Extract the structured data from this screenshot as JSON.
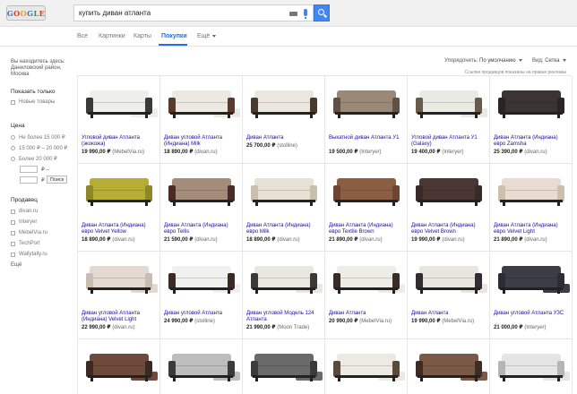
{
  "search": {
    "query": "купить диван атланта",
    "logo_text": "GOOGLE"
  },
  "tabs": [
    {
      "label": "Все",
      "active": false
    },
    {
      "label": "Картинки",
      "active": false
    },
    {
      "label": "Карты",
      "active": false
    },
    {
      "label": "Покупки",
      "active": true
    },
    {
      "label": "Ещё",
      "active": false
    }
  ],
  "sidebar": {
    "location": "Вы находитесь здесь: Даниловский район, Москва",
    "show_only_title": "Показать только",
    "new_items": "Новые товары",
    "price_title": "Цена",
    "price_options": [
      "Не более 15 000 ₽",
      "15 000 ₽ – 20 000 ₽",
      "Более 20 000 ₽"
    ],
    "price_from_suffix": "₽ –",
    "price_to_suffix": "₽",
    "price_button": "Поиск",
    "seller_title": "Продавец",
    "sellers": [
      "divan.ru",
      "Interyer",
      "MebelVia.ru",
      "TechPort",
      "Wallytally.ru"
    ],
    "more": "Ещё"
  },
  "controls": {
    "sort_label": "Упорядочить:",
    "sort_value": "По умолчанию",
    "view_label": "Вид:",
    "view_value": "Сетка",
    "ads_note": "Ссылки продавцов показаны на правах рекламы"
  },
  "products": [
    {
      "title": "Угловой диван Атланта (экокожа)",
      "price": "19 990,00 ₽",
      "seller": "(MebelVia.ru)",
      "color": "#eeeeea",
      "accent": "#3a3a3a",
      "corner": true
    },
    {
      "title": "Диван угловой Атланта (Индиана) Milk",
      "price": "18 890,00 ₽",
      "seller": "(divan.ru)",
      "color": "#ece9e1",
      "accent": "#5a3b2b",
      "corner": true
    },
    {
      "title": "Диван Атланта",
      "price": "25 700,00 ₽",
      "seller": "(stolline)",
      "color": "#ebe7df",
      "accent": "#4a3a2e",
      "corner": false
    },
    {
      "title": "Выкатной диван Атланта У1",
      "price": "19 500,00 ₽",
      "seller": "(Interyer)",
      "color": "#9c8877",
      "accent": "#5f5145",
      "corner": false
    },
    {
      "title": "Угловой диван Атланта У1 (Galaxy)",
      "price": "19 400,00 ₽",
      "seller": "(Interyer)",
      "color": "#eaeae5",
      "accent": "#6b5a4a",
      "corner": true
    },
    {
      "title": "Диван Атланта (Индиана) евро Zаmsha",
      "price": "25 390,00 ₽",
      "seller": "(divan.ru)",
      "color": "#3b3432",
      "accent": "#2a2423",
      "corner": false
    },
    {
      "title": "Диван Атланта (Индиана) евро Velvet Yellow",
      "price": "18 890,00 ₽",
      "seller": "(divan.ru)",
      "color": "#b8ad33",
      "accent": "#8f8626",
      "corner": false
    },
    {
      "title": "Диван Атланта (Индиана) евро Tellis",
      "price": "21 590,00 ₽",
      "seller": "(divan.ru)",
      "color": "#a38c79",
      "accent": "#4b2c24",
      "corner": false
    },
    {
      "title": "Диван Атланта (Индиана) евро Milk",
      "price": "18 890,00 ₽",
      "seller": "(divan.ru)",
      "color": "#e6e1d3",
      "accent": "#c8c0ad",
      "corner": false
    },
    {
      "title": "Диван Атланта (Индиана) евро Textile Brown",
      "price": "21 890,00 ₽",
      "seller": "(divan.ru)",
      "color": "#8b5e44",
      "accent": "#6c4632",
      "corner": false
    },
    {
      "title": "Диван Атланта (Индиана) евро Velvet Brown",
      "price": "19 990,00 ₽",
      "seller": "(divan.ru)",
      "color": "#4a3632",
      "accent": "#3a2a27",
      "corner": false
    },
    {
      "title": "Диван Атланта (Индиана) евро Velvet Light",
      "price": "21 890,00 ₽",
      "seller": "(divan.ru)",
      "color": "#e7dccf",
      "accent": "#cbbfae",
      "corner": false
    },
    {
      "title": "Диван угловой Атланта (Индиана) Velvet Light",
      "price": "22 990,00 ₽",
      "seller": "(divan.ru)",
      "color": "#e3d9d0",
      "accent": "#c9bdb2",
      "corner": true
    },
    {
      "title": "Диван угловой Атланта",
      "price": "24 990,00 ₽",
      "seller": "(stolline)",
      "color": "#f0f0ee",
      "accent": "#3b2b25",
      "corner": true
    },
    {
      "title": "Диван угловой Модель 124 Атланта",
      "price": "21 990,00 ₽",
      "seller": "(Moon Trade)",
      "color": "#e9e7df",
      "accent": "#3a3a36",
      "corner": true
    },
    {
      "title": "Диван Атланта",
      "price": "20 990,00 ₽",
      "seller": "(MebelVia.ru)",
      "color": "#efece5",
      "accent": "#3a2c26",
      "corner": true
    },
    {
      "title": "Диван Атланта",
      "price": "19 990,00 ₽",
      "seller": "(MebelVia.ru)",
      "color": "#e9e6df",
      "accent": "#2f2f2f",
      "corner": true
    },
    {
      "title": "Диван угловой Атланта УЗС",
      "price": "21 000,00 ₽",
      "seller": "(Interyer)",
      "color": "#3b3f45",
      "accent": "#2a2d31",
      "corner": true
    },
    {
      "title": "",
      "price": "",
      "seller": "",
      "color": "#6e4a3a",
      "accent": "#3a2a22",
      "corner": true
    },
    {
      "title": "",
      "price": "",
      "seller": "",
      "color": "#bdbdbd",
      "accent": "#3a3a3a",
      "corner": true
    },
    {
      "title": "",
      "price": "",
      "seller": "",
      "color": "#6a6a6a",
      "accent": "#3b3b3b",
      "corner": true
    },
    {
      "title": "",
      "price": "",
      "seller": "",
      "color": "#eceae3",
      "accent": "#5a4a3a",
      "corner": true
    },
    {
      "title": "",
      "price": "",
      "seller": "",
      "color": "#7a5a46",
      "accent": "#3e2c22",
      "corner": true
    },
    {
      "title": "",
      "price": "",
      "seller": "",
      "color": "#e5e5e5",
      "accent": "#b5b5b5",
      "corner": true
    }
  ]
}
